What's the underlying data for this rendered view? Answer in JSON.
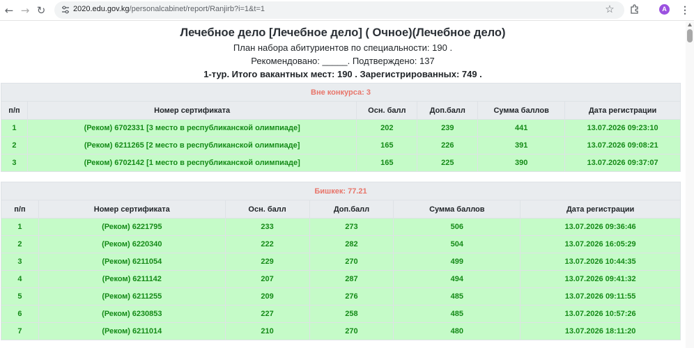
{
  "browser": {
    "url_host": "2020.edu.gov.kg",
    "url_path": "/personalcabinet/report/Ranjirb?i=1&t=1",
    "avatar_letter": "A",
    "icons": [
      "back-icon",
      "forward-icon",
      "reload-icon",
      "site-info-icon",
      "star-icon",
      "extensions-icon",
      "menu-icon"
    ]
  },
  "header": {
    "title": "Лечебное дело [Лечебное дело] ( Очное)(Лечебное дело)",
    "plan": "План набора абитуриентов по специальности: 190 .",
    "recommended": "Рекомендовано: _____. Подтверждено: 137",
    "summary": "1-тур. Итого вакантных мест: 190 . Зарегистрированных: 749 ."
  },
  "colors": {
    "caption": "#e8756a",
    "row_bg": "#c5fbc8",
    "row_text": "#148a17",
    "header_bg": "#e9ecef"
  },
  "table1": {
    "caption": "Вне конкурса: 3",
    "columns": [
      "п/п",
      "Номер сертификата",
      "Осн. балл",
      "Доп.балл",
      "Сумма баллов",
      "Дата регистрации"
    ],
    "rows": [
      [
        "1",
        "(Реком) 6702331 [3 место в республиканской олимпиаде]",
        "202",
        "239",
        "441",
        "13.07.2026 09:23:10"
      ],
      [
        "2",
        "(Реком) 6211265 [2 место в республиканской олимпиаде]",
        "165",
        "226",
        "391",
        "13.07.2026 09:08:21"
      ],
      [
        "3",
        "(Реком) 6702142 [1 место в республиканской олимпиаде]",
        "165",
        "225",
        "390",
        "13.07.2026 09:37:07"
      ]
    ]
  },
  "table2": {
    "caption": "Бишкек: 77.21",
    "columns": [
      "п/п",
      "Номер сертификата",
      "Осн. балл",
      "Доп.балл",
      "Сумма баллов",
      "Дата регистрации"
    ],
    "rows": [
      [
        "1",
        "(Реком) 6221795",
        "233",
        "273",
        "506",
        "13.07.2026 09:36:46"
      ],
      [
        "2",
        "(Реком) 6220340",
        "222",
        "282",
        "504",
        "13.07.2026 16:05:29"
      ],
      [
        "3",
        "(Реком) 6211054",
        "229",
        "270",
        "499",
        "13.07.2026 10:44:35"
      ],
      [
        "4",
        "(Реком) 6211142",
        "207",
        "287",
        "494",
        "13.07.2026 09:41:32"
      ],
      [
        "5",
        "(Реком) 6211255",
        "209",
        "276",
        "485",
        "13.07.2026 09:11:55"
      ],
      [
        "6",
        "(Реком) 6230853",
        "227",
        "258",
        "485",
        "13.07.2026 10:57:26"
      ],
      [
        "7",
        "(Реком) 6211014",
        "210",
        "270",
        "480",
        "13.07.2026 18:11:20"
      ]
    ]
  }
}
